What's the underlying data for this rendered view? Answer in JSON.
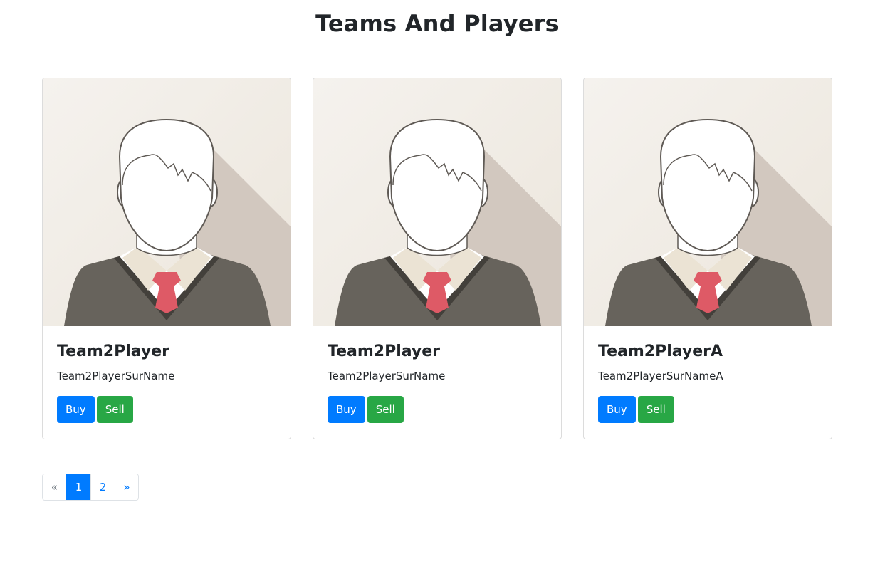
{
  "page": {
    "title": "Teams And Players"
  },
  "players": [
    {
      "name": "Team2Player",
      "surname": "Team2PlayerSurName",
      "buy_label": "Buy",
      "sell_label": "Sell",
      "avatar_icon": "avatar-placeholder-icon"
    },
    {
      "name": "Team2Player",
      "surname": "Team2PlayerSurName",
      "buy_label": "Buy",
      "sell_label": "Sell",
      "avatar_icon": "avatar-placeholder-icon"
    },
    {
      "name": "Team2PlayerA",
      "surname": "Team2PlayerSurNameA",
      "buy_label": "Buy",
      "sell_label": "Sell",
      "avatar_icon": "avatar-placeholder-icon"
    }
  ],
  "pagination": {
    "prev_label": "«",
    "next_label": "»",
    "pages": [
      "1",
      "2"
    ],
    "active_page": "1"
  },
  "colors": {
    "primary": "#007bff",
    "success": "#28a745",
    "avatar_background": "#f1ede6",
    "avatar_shadow": "#d2c8bf",
    "avatar_sweater": "#67635c",
    "avatar_tie": "#de5a66"
  }
}
